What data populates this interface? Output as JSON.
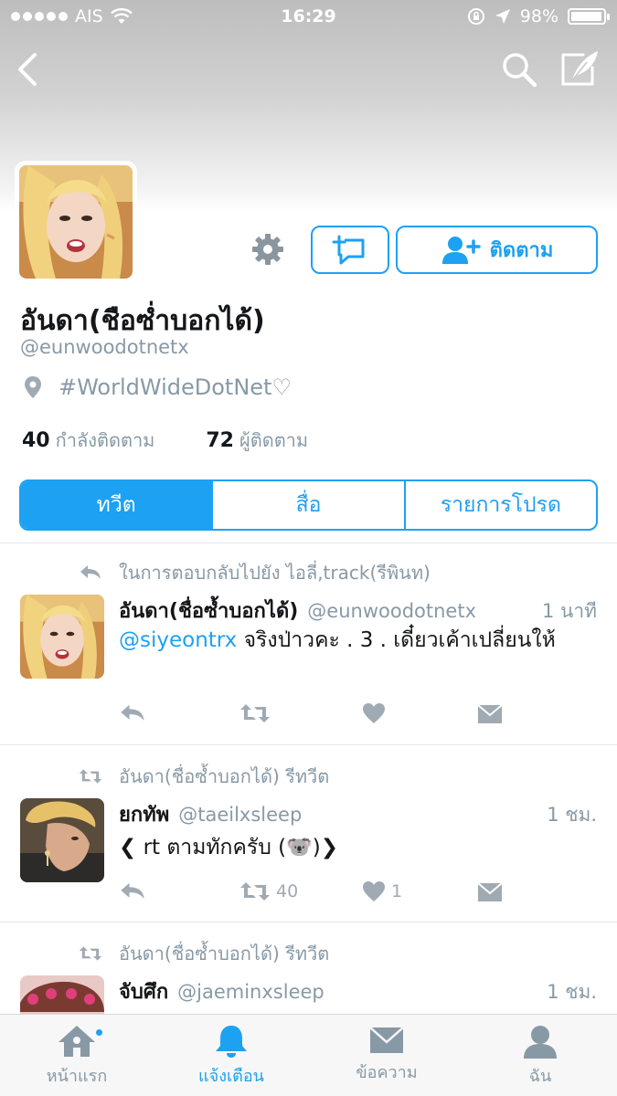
{
  "status_bar": {
    "carrier": "AIS",
    "time": "16:29",
    "battery": "98%",
    "battery_level": 0.98
  },
  "header": {
    "back_icon": "chevron-left-icon",
    "search_icon": "search-icon",
    "compose_icon": "compose-feather-icon"
  },
  "profile": {
    "name": "อันดา(ชือซ่ำบอกได้)",
    "handle": "@eunwoodotnetx",
    "location": "#WorldWideDotNet♡",
    "following_count": "40",
    "following_label": "กำลังติดตาม",
    "followers_count": "72",
    "followers_label": "ผู้ติดตาม",
    "follow_label": "ติดตาม"
  },
  "tabs": [
    {
      "label": "ทวีต",
      "active": true
    },
    {
      "label": "สื่อ",
      "active": false
    },
    {
      "label": "รายการโปรด",
      "active": false
    }
  ],
  "tweets": [
    {
      "context": "ในการตอบกลับไปยัง ไอลี่,track(รีพินท)",
      "name": "อันดา(ชื่อซ้ำบอกได้)",
      "handle": "@eunwoodotnetx",
      "time": "1 นาที",
      "mention": "@siyeontrx",
      "text": " จริงป่าวคะ . 3 . เดี๋ยวเค้าเปลี่ยนให้",
      "retweets": "",
      "likes": ""
    },
    {
      "context": "อันดา(ชื่อซ้ำบอกได้) รีทวีต",
      "name": "ยกทัพ",
      "handle": "@taeilxsleep",
      "time": "1 ชม.",
      "text": "❮ rt ตามทักครับ (🐨)❯",
      "retweets": "40",
      "likes": "1"
    },
    {
      "context": "อันดา(ชื่อซ้ำบอกได้) รีทวีต",
      "name": "จับศึก",
      "handle": "@jaeminxsleep",
      "time": "1 ชม."
    }
  ],
  "tabbar": [
    {
      "label": "หน้าแรก",
      "icon": "home-icon"
    },
    {
      "label": "แจ้งเตือน",
      "icon": "bell-icon",
      "active": true
    },
    {
      "label": "ข้อความ",
      "icon": "envelope-icon"
    },
    {
      "label": "ฉัน",
      "icon": "person-icon"
    }
  ],
  "colors": {
    "accent": "#1da1f2",
    "muted": "#8899a6",
    "icon_gray": "#a0aab3"
  }
}
